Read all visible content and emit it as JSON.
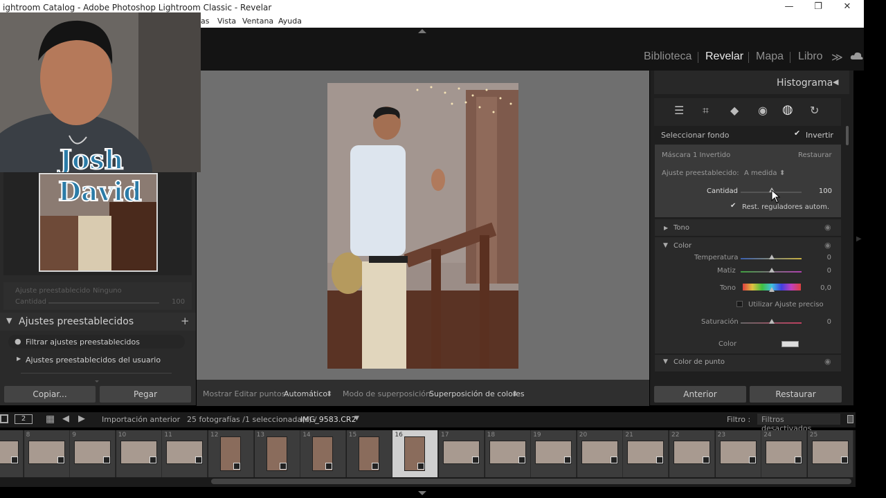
{
  "window": {
    "title": "ightroom Catalog - Adobe Photoshop Lightroom Classic - Revelar",
    "minimize": "—",
    "maximize": "❐",
    "close": "✕"
  },
  "menu": [
    "as",
    "Vista",
    "Ventana",
    "Ayuda"
  ],
  "modules": [
    {
      "label": "Biblioteca",
      "active": false
    },
    {
      "label": "Revelar",
      "active": true
    },
    {
      "label": "Mapa",
      "active": false
    },
    {
      "label": "Libro",
      "active": false
    }
  ],
  "more_modules": "≫",
  "webcam": {
    "overlay_line1": "Josh",
    "overlay_line2": "David"
  },
  "left_panel": {
    "preset_adjust_label": "Ajuste preestablecido",
    "preset_adjust_value": "Ninguno",
    "amount_label": "Cantidad",
    "amount_value": "100",
    "presets_header": "Ajustes preestablecidos",
    "filter_presets": "Filtrar ajustes preestablecidos",
    "user_presets": "Ajustes preestablecidos del usuario",
    "copy_button": "Copiar...",
    "paste_button": "Pegar"
  },
  "center_toolbar": {
    "show_edit_points_label": "Mostrar Editar puntos:",
    "show_edit_points_value": "Automático",
    "overlay_mode_label": "Modo de superposición:",
    "overlay_mode_value": "Superposición de colores"
  },
  "right_panel": {
    "histogram_title": "Histograma",
    "select_background": "Seleccionar fondo",
    "invert_label": "Invertir",
    "mask_name": "Máscara 1 Invertido",
    "restore_link": "Restaurar",
    "preset_label": "Ajuste preestablecido:",
    "preset_value": "A medida",
    "amount_label": "Cantidad",
    "amount_value": "100",
    "amount_fraction": 0.5,
    "auto_reset_label": "Rest. reguladores autom.",
    "tone_section": "Tono",
    "color_section": "Color",
    "temperature_label": "Temperatura",
    "temperature_value": "0",
    "tint_label": "Matiz",
    "tint_value": "0",
    "hue_label": "Tono",
    "hue_value": "0,0",
    "fine_adjust_label": "Utilizar Ajuste preciso",
    "saturation_label": "Saturación",
    "saturation_value": "0",
    "color_label": "Color",
    "point_color_section": "Color de punto",
    "prev_button": "Anterior",
    "reset_button": "Restaurar"
  },
  "filmstrip": {
    "view1": "1",
    "view2": "2",
    "source": "Importación anterior",
    "count": "25 fotografías /1 seleccionada(s) /",
    "filename": "IMG_9583.CR2",
    "filter_label": "Filtro :",
    "filter_value": "Filtros desactivados",
    "cells": [
      {
        "num": "",
        "portrait": false
      },
      {
        "num": "8",
        "portrait": false
      },
      {
        "num": "9",
        "portrait": false
      },
      {
        "num": "10",
        "portrait": false
      },
      {
        "num": "11",
        "portrait": false
      },
      {
        "num": "12",
        "portrait": true
      },
      {
        "num": "13",
        "portrait": true
      },
      {
        "num": "14",
        "portrait": true
      },
      {
        "num": "15",
        "portrait": true
      },
      {
        "num": "16",
        "portrait": true,
        "selected": true
      },
      {
        "num": "17",
        "portrait": false
      },
      {
        "num": "18",
        "portrait": false
      },
      {
        "num": "19",
        "portrait": false
      },
      {
        "num": "20",
        "portrait": false
      },
      {
        "num": "21",
        "portrait": false
      },
      {
        "num": "22",
        "portrait": false
      },
      {
        "num": "23",
        "portrait": false
      },
      {
        "num": "24",
        "portrait": false
      },
      {
        "num": "25",
        "portrait": false
      }
    ]
  },
  "colors": {
    "accent": "#e8e8e8",
    "panel": "#2a2a2a",
    "canvas": "#6f6f6f"
  }
}
